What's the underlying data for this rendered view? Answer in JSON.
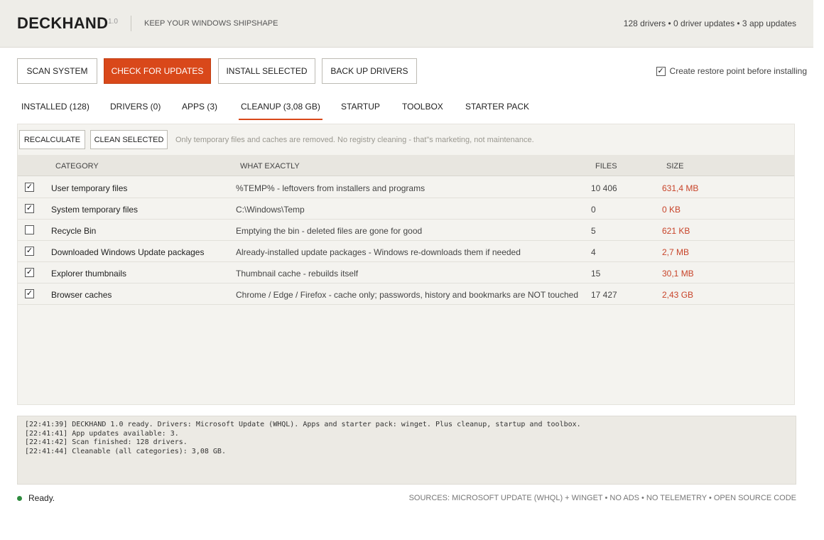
{
  "app": {
    "name": "DECKHAND",
    "version": "1.0",
    "tagline": "KEEP YOUR WINDOWS SHIPSHAPE",
    "status": "128 drivers • 0 driver updates • 3 app updates"
  },
  "actions": {
    "scan": "SCAN SYSTEM",
    "check_updates": "CHECK FOR UPDATES",
    "install_selected": "INSTALL SELECTED",
    "backup_drivers": "BACK UP DRIVERS",
    "restore_point_label": "Create restore point before installing",
    "restore_point_checked": true
  },
  "tabs": [
    {
      "label": "INSTALLED (128)"
    },
    {
      "label": "DRIVERS (0)"
    },
    {
      "label": "APPS (3)"
    },
    {
      "label": "CLEANUP (3,08 GB)",
      "active": true
    },
    {
      "label": "STARTUP"
    },
    {
      "label": "TOOLBOX"
    },
    {
      "label": "STARTER PACK"
    }
  ],
  "cleanup": {
    "recalculate": "RECALCULATE",
    "clean_selected": "CLEAN SELECTED",
    "hint": "Only temporary files and caches are removed. No registry cleaning - that\"s marketing, not maintenance.",
    "columns": {
      "category": "CATEGORY",
      "what": "WHAT EXACTLY",
      "files": "FILES",
      "size": "SIZE"
    },
    "rows": [
      {
        "checked": true,
        "category": "User temporary files",
        "what": "%TEMP% - leftovers from installers and programs",
        "files": "10 406",
        "size": "631,4 MB"
      },
      {
        "checked": true,
        "category": "System temporary files",
        "what": "C:\\Windows\\Temp",
        "files": "0",
        "size": "0 KB"
      },
      {
        "checked": false,
        "category": "Recycle Bin",
        "what": "Emptying the bin - deleted files are gone for good",
        "files": "5",
        "size": "621 KB"
      },
      {
        "checked": true,
        "category": "Downloaded Windows Update packages",
        "what": "Already-installed update packages - Windows re-downloads them if needed",
        "files": "4",
        "size": "2,7 MB"
      },
      {
        "checked": true,
        "category": "Explorer thumbnails",
        "what": "Thumbnail cache - rebuilds itself",
        "files": "15",
        "size": "30,1 MB"
      },
      {
        "checked": true,
        "category": "Browser caches",
        "what": "Chrome / Edge / Firefox - cache only; passwords, history and bookmarks are NOT touched",
        "files": "17 427",
        "size": "2,43 GB"
      }
    ]
  },
  "log": [
    "[22:41:39] DECKHAND 1.0 ready. Drivers: Microsoft Update (WHQL). Apps and starter pack: winget. Plus cleanup, startup and toolbox.",
    "[22:41:41] App updates available: 3.",
    "[22:41:42] Scan finished: 128 drivers.",
    "[22:41:44] Cleanable (all categories): 3,08 GB."
  ],
  "footer": {
    "status": "Ready.",
    "sources": "SOURCES: MICROSOFT UPDATE (WHQL) + WINGET • NO ADS • NO TELEMETRY • OPEN SOURCE CODE"
  },
  "colors": {
    "accent": "#d9481a",
    "size_text": "#c8442a",
    "ready_dot": "#2e8b3e"
  }
}
